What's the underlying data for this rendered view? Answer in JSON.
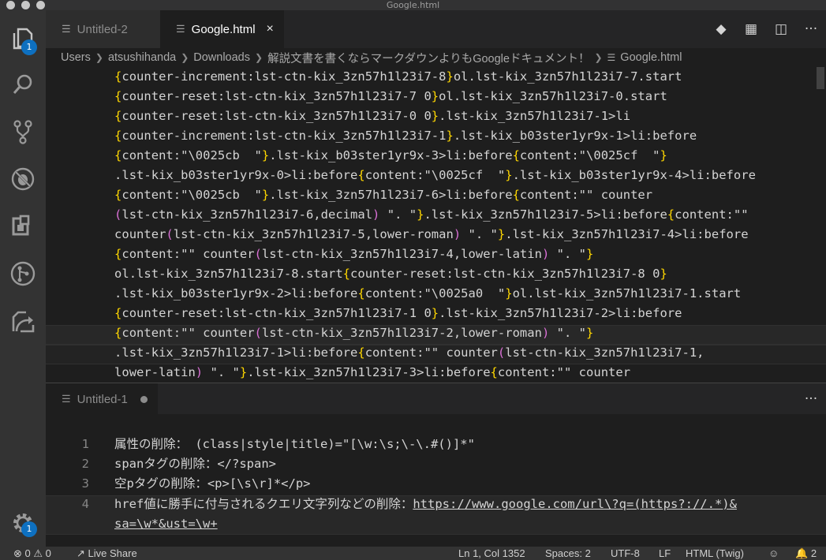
{
  "window": {
    "title": "Google.html"
  },
  "activity_bar": {
    "items": [
      {
        "name": "explorer",
        "icon": "files-icon",
        "badge": "1"
      },
      {
        "name": "search",
        "icon": "search-icon"
      },
      {
        "name": "source-control",
        "icon": "source-control-icon"
      },
      {
        "name": "debug",
        "icon": "debug-icon"
      },
      {
        "name": "extensions",
        "icon": "extensions-icon"
      },
      {
        "name": "gitlens",
        "icon": "gitlens-icon"
      },
      {
        "name": "live-share",
        "icon": "live-share-icon"
      }
    ],
    "settings_badge": "1"
  },
  "tabs": [
    {
      "label": "Untitled-2",
      "active": false
    },
    {
      "label": "Google.html",
      "active": true,
      "close": "×"
    }
  ],
  "tab_actions": {
    "more": "···"
  },
  "breadcrumb": [
    "Users",
    "atsushihanda",
    "Downloads",
    "解説文書を書くならマークダウンよりもGoogleドキュメント！",
    "Google.html"
  ],
  "code_top": [
    "{counter-increment:lst-ctn-kix_3zn57h1l23i7-8}ol.lst-kix_3zn57h1l23i7-7.start",
    "{counter-reset:lst-ctn-kix_3zn57h1l23i7-7 0}ol.lst-kix_3zn57h1l23i7-0.start",
    "{counter-reset:lst-ctn-kix_3zn57h1l23i7-0 0}.lst-kix_3zn57h1l23i7-1>li",
    "{counter-increment:lst-ctn-kix_3zn57h1l23i7-1}.lst-kix_b03ster1yr9x-1>li:before",
    "{content:\"\\0025cb  \"}.lst-kix_b03ster1yr9x-3>li:before{content:\"\\0025cf  \"}",
    ".lst-kix_b03ster1yr9x-0>li:before{content:\"\\0025cf  \"}.lst-kix_b03ster1yr9x-4>li:before",
    "{content:\"\\0025cb  \"}.lst-kix_3zn57h1l23i7-6>li:before{content:\"\" counter",
    "(lst-ctn-kix_3zn57h1l23i7-6,decimal) \". \"}.lst-kix_3zn57h1l23i7-5>li:before{content:\"\"",
    "counter(lst-ctn-kix_3zn57h1l23i7-5,lower-roman) \". \"}.lst-kix_3zn57h1l23i7-4>li:before",
    "{content:\"\" counter(lst-ctn-kix_3zn57h1l23i7-4,lower-latin) \". \"}",
    "ol.lst-kix_3zn57h1l23i7-8.start{counter-reset:lst-ctn-kix_3zn57h1l23i7-8 0}",
    ".lst-kix_b03ster1yr9x-2>li:before{content:\"\\0025a0  \"}ol.lst-kix_3zn57h1l23i7-1.start",
    "{counter-reset:lst-ctn-kix_3zn57h1l23i7-1 0}.lst-kix_3zn57h1l23i7-2>li:before",
    "{content:\"\" counter(lst-ctn-kix_3zn57h1l23i7-2,lower-roman) \". \"}",
    ".lst-kix_3zn57h1l23i7-1>li:before{content:\"\" counter(lst-ctn-kix_3zn57h1l23i7-1,",
    "lower-latin) \". \"}.lst-kix_3zn57h1l23i7-3>li:before{content:\"\" counter"
  ],
  "group2": {
    "tab_label": "Untitled-1",
    "more": "···"
  },
  "code_bottom": {
    "line_numbers": [
      "1",
      "2",
      "3",
      "4"
    ],
    "lines": [
      "属性の削除： (class|style|title)=\"[\\w:\\s;\\-\\.#()]*\"",
      "spanタグの削除：</?span>",
      "空pタグの削除：<p>[\\s\\r]*</p>",
      "href値に勝手に付与されるクエリ文字列などの削除：",
      "https://www.google.com/url\\?q=(https?://.*)&",
      "sa=\\w*&ust=\\w+"
    ]
  },
  "statusbar": {
    "errors": "0",
    "warnings": "0",
    "live_share": "Live Share",
    "position": "Ln 1, Col 1352",
    "spaces": "Spaces: 2",
    "encoding": "UTF-8",
    "eol": "LF",
    "language": "HTML (Twig)",
    "notifications": "2"
  },
  "colors": {
    "bracket_1": "#ffd700",
    "bracket_2": "#da70d6",
    "badge": "#0e70c0",
    "editor_bg": "#1e1e1e"
  }
}
